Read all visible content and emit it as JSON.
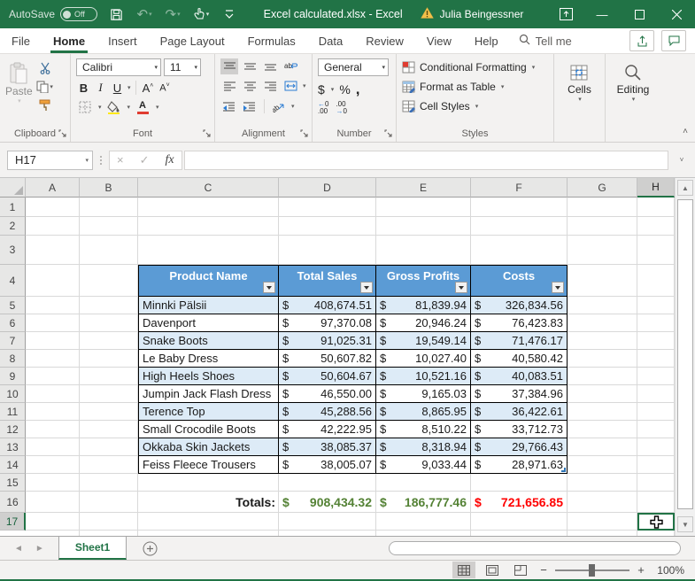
{
  "titlebar": {
    "autosave_label": "AutoSave",
    "autosave_state": "Off",
    "title": "Excel calculated.xlsx  -  Excel",
    "user_name": "Julia Beingessner"
  },
  "ribbon_tabs": [
    "File",
    "Home",
    "Insert",
    "Page Layout",
    "Formulas",
    "Data",
    "Review",
    "View",
    "Help"
  ],
  "search": {
    "tell_me_label": "Tell me"
  },
  "ribbon": {
    "clipboard": {
      "label": "Clipboard",
      "paste_label": "Paste"
    },
    "font": {
      "label": "Font",
      "font_name": "Calibri",
      "font_size": "11",
      "bold": "B",
      "italic": "I",
      "underline": "U",
      "grow": "A",
      "shrink": "A",
      "color_a": "A"
    },
    "alignment": {
      "label": "Alignment"
    },
    "number": {
      "label": "Number",
      "format_value": "General",
      "currency": "$",
      "percent": "%",
      "comma": ","
    },
    "styles": {
      "label": "Styles",
      "items": [
        "Conditional Formatting",
        "Format as Table",
        "Cell Styles"
      ]
    },
    "cells": {
      "label": "Cells"
    },
    "editing": {
      "label": "Editing"
    }
  },
  "formula_bar": {
    "name_box": "H17",
    "fx_label": "fx",
    "formula_value": ""
  },
  "grid": {
    "columns": [
      "A",
      "B",
      "C",
      "D",
      "E",
      "F",
      "G",
      "H"
    ],
    "rows": [
      "1",
      "2",
      "3",
      "4",
      "5",
      "6",
      "7",
      "8",
      "9",
      "10",
      "11",
      "12",
      "13",
      "14",
      "15",
      "16",
      "17"
    ],
    "selected_cell": "H17",
    "selected_column": "H",
    "selected_row": "17"
  },
  "table": {
    "headers": [
      "Product Name",
      "Total Sales",
      "Gross Profits",
      "Costs"
    ],
    "currency": "$",
    "rows": [
      {
        "name": "Minnki Pälsii",
        "sales": "408,674.51",
        "profit": "81,839.94",
        "cost": "326,834.56"
      },
      {
        "name": "Davenport",
        "sales": "97,370.08",
        "profit": "20,946.24",
        "cost": "76,423.83"
      },
      {
        "name": "Snake Boots",
        "sales": "91,025.31",
        "profit": "19,549.14",
        "cost": "71,476.17"
      },
      {
        "name": "Le Baby Dress",
        "sales": "50,607.82",
        "profit": "10,027.40",
        "cost": "40,580.42"
      },
      {
        "name": "High Heels Shoes",
        "sales": "50,604.67",
        "profit": "10,521.16",
        "cost": "40,083.51"
      },
      {
        "name": "Jumpin Jack Flash Dress",
        "sales": "46,550.00",
        "profit": "9,165.03",
        "cost": "37,384.96"
      },
      {
        "name": "Terence Top",
        "sales": "45,288.56",
        "profit": "8,865.95",
        "cost": "36,422.61"
      },
      {
        "name": "Small Crocodile Boots",
        "sales": "42,222.95",
        "profit": "8,510.22",
        "cost": "33,712.73"
      },
      {
        "name": "Okkaba Skin Jackets",
        "sales": "38,085.37",
        "profit": "8,318.94",
        "cost": "29,766.43"
      },
      {
        "name": "Feiss Fleece Trousers",
        "sales": "38,005.07",
        "profit": "9,033.44",
        "cost": "28,971.63"
      }
    ],
    "totals_label": "Totals:",
    "totals": {
      "sales": "908,434.32",
      "profit": "186,777.46",
      "cost": "721,656.85"
    }
  },
  "sheet_tabs": {
    "active_tab": "Sheet1"
  },
  "status_bar": {
    "zoom_level": "100%"
  },
  "colors": {
    "excel_green": "#217346",
    "table_header_blue": "#5B9BD5",
    "banded_row_blue": "#DDEBF7",
    "totals_green": "#548235",
    "totals_red": "#FF0000"
  }
}
